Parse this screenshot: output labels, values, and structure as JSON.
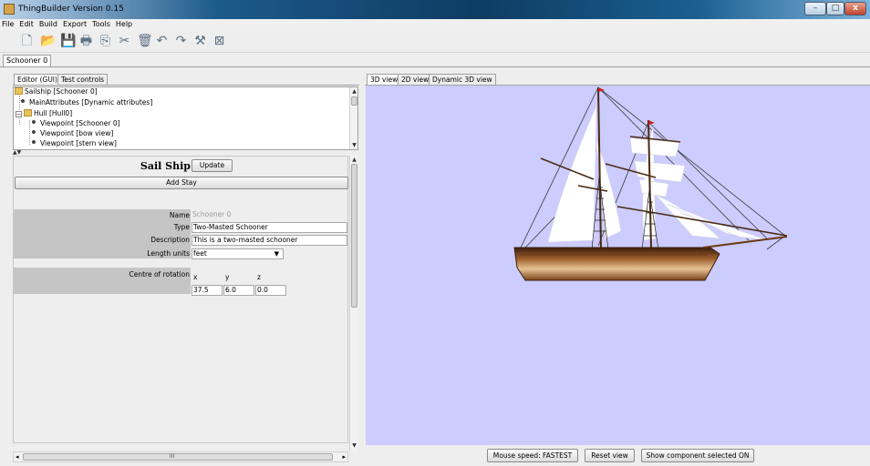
{
  "window": {
    "title": "ThingBuilder Version 0.15"
  },
  "menu": [
    "File",
    "Edit",
    "Build",
    "Export",
    "Tools",
    "Help"
  ],
  "toolbar": {
    "icons": [
      "new-icon",
      "open-icon",
      "save-icon",
      "print-icon",
      "copy-icon",
      "cut-icon",
      "delete-icon",
      "undo-icon",
      "redo-icon",
      "build-icon",
      "close-view-icon"
    ],
    "glyphs": [
      "🗋",
      "📂",
      "💾",
      "🖶",
      "⎘",
      "✂",
      "🗑",
      "↶",
      "↷",
      "⚒",
      "⊠"
    ]
  },
  "document_tab": "Schooner 0",
  "left_tabs": [
    "Editor (GUI)",
    "Test controls"
  ],
  "tree": {
    "items": [
      "Sailship [Schooner 0]",
      "MainAttributes [Dynamic attributes]",
      "Hull [Hull0]",
      "Viewpoint [Schooner 0]",
      "Viewpoint [bow view]",
      "Viewpoint [stern view]"
    ]
  },
  "form": {
    "title": "Sail Ship",
    "update_label": "Update",
    "add_stay_label": "Add Stay",
    "fields": {
      "name_label": "Name",
      "name_value": "Schooner 0",
      "type_label": "Type",
      "type_value": "Two-Masted Schooner",
      "description_label": "Description",
      "description_value": "This is a two-masted schooner",
      "length_units_label": "Length units",
      "length_units_value": "feet"
    },
    "centre": {
      "label": "Centre of rotation",
      "x_label": "x",
      "y_label": "y",
      "z_label": "z",
      "x": "37.5",
      "y": "6.0",
      "z": "0.0"
    }
  },
  "hscroll_label": "III",
  "view_tabs": [
    "3D view",
    "2D view",
    "Dynamic 3D view"
  ],
  "status": {
    "mouse_speed": "Mouse speed: FASTEST",
    "reset": "Reset view",
    "show_component": "Show component selected  ON"
  },
  "colors": {
    "viewport_bg": "#ccccfe",
    "hull": "#a0622e",
    "sail": "#ffffff",
    "pennant": "#c62020"
  }
}
